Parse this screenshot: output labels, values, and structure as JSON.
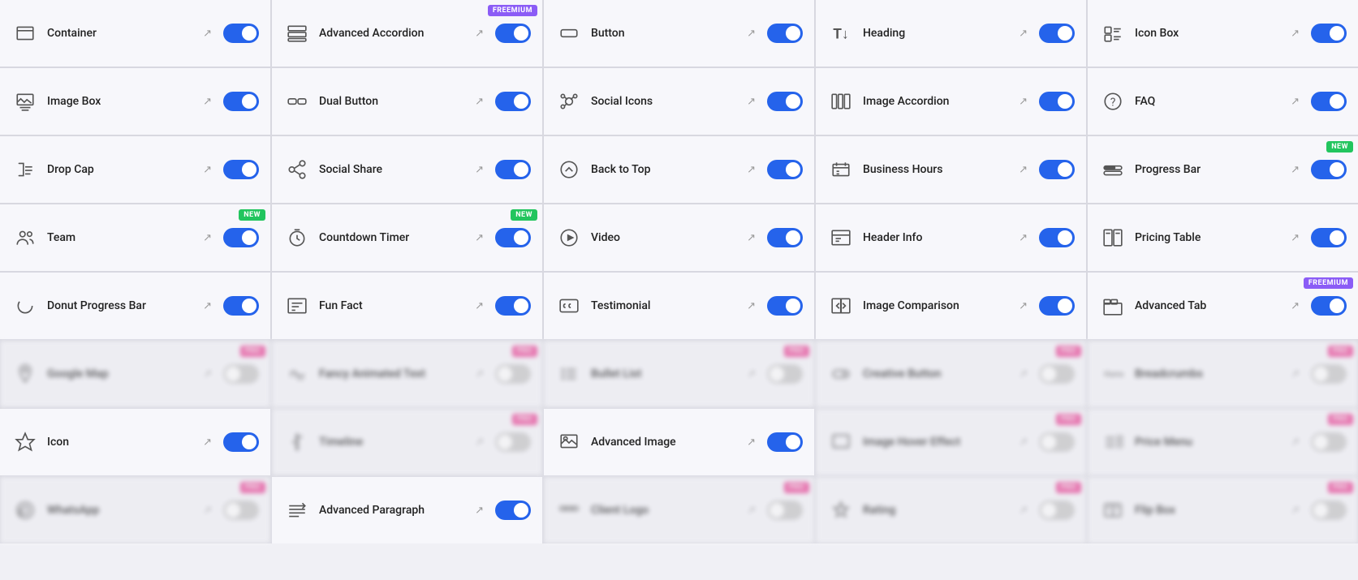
{
  "colors": {
    "toggle_on": "#2563eb",
    "toggle_off": "#cccccc",
    "badge_new": "#22c55e",
    "badge_freemium": "#8b5cf6",
    "badge_pro": "#ec4899"
  },
  "cells": [
    {
      "id": "container",
      "label": "Container",
      "icon": "container",
      "toggle": "on",
      "badge": null
    },
    {
      "id": "advanced-accordion",
      "label": "Advanced Accordion",
      "icon": "advanced-accordion",
      "toggle": "on",
      "badge": "freemium"
    },
    {
      "id": "button",
      "label": "Button",
      "icon": "button",
      "toggle": "on",
      "badge": null
    },
    {
      "id": "heading",
      "label": "Heading",
      "icon": "heading",
      "toggle": "on",
      "badge": null
    },
    {
      "id": "icon-box",
      "label": "Icon Box",
      "icon": "icon-box",
      "toggle": "on",
      "badge": null
    },
    {
      "id": "image-box",
      "label": "Image Box",
      "icon": "image-box",
      "toggle": "on",
      "badge": null
    },
    {
      "id": "dual-button",
      "label": "Dual Button",
      "icon": "dual-button",
      "toggle": "on",
      "badge": null
    },
    {
      "id": "social-icons",
      "label": "Social Icons",
      "icon": "social-icons",
      "toggle": "on",
      "badge": null
    },
    {
      "id": "image-accordion",
      "label": "Image Accordion",
      "icon": "image-accordion",
      "toggle": "on",
      "badge": null
    },
    {
      "id": "faq",
      "label": "FAQ",
      "icon": "faq",
      "toggle": "on",
      "badge": null
    },
    {
      "id": "drop-cap",
      "label": "Drop Cap",
      "icon": "drop-cap",
      "toggle": "on",
      "badge": null
    },
    {
      "id": "social-share",
      "label": "Social Share",
      "icon": "social-share",
      "toggle": "on",
      "badge": null
    },
    {
      "id": "back-to-top",
      "label": "Back to Top",
      "icon": "back-to-top",
      "toggle": "on",
      "badge": null
    },
    {
      "id": "business-hours",
      "label": "Business Hours",
      "icon": "business-hours",
      "toggle": "on",
      "badge": null
    },
    {
      "id": "progress-bar",
      "label": "Progress Bar",
      "icon": "progress-bar",
      "toggle": "on",
      "badge": "new"
    },
    {
      "id": "team",
      "label": "Team",
      "icon": "team",
      "toggle": "on",
      "badge": "new"
    },
    {
      "id": "countdown-timer",
      "label": "Countdown Timer",
      "icon": "countdown-timer",
      "toggle": "on",
      "badge": "new"
    },
    {
      "id": "video",
      "label": "Video",
      "icon": "video",
      "toggle": "on",
      "badge": null
    },
    {
      "id": "header-info",
      "label": "Header Info",
      "icon": "header-info",
      "toggle": "on",
      "badge": null
    },
    {
      "id": "pricing-table",
      "label": "Pricing Table",
      "icon": "pricing-table",
      "toggle": "on",
      "badge": null
    },
    {
      "id": "donut-progress-bar",
      "label": "Donut Progress Bar",
      "icon": "donut-progress",
      "toggle": "on",
      "badge": null
    },
    {
      "id": "fun-fact",
      "label": "Fun Fact",
      "icon": "fun-fact",
      "toggle": "on",
      "badge": null
    },
    {
      "id": "testimonial",
      "label": "Testimonial",
      "icon": "testimonial",
      "toggle": "on",
      "badge": null
    },
    {
      "id": "image-comparison",
      "label": "Image Comparison",
      "icon": "image-comparison",
      "toggle": "on",
      "badge": null
    },
    {
      "id": "advanced-tab",
      "label": "Advanced Tab",
      "icon": "advanced-tab",
      "toggle": "on",
      "badge": "freemium"
    },
    {
      "id": "google-map",
      "label": "Google Map",
      "icon": "google-map",
      "toggle": "off",
      "badge": "pro",
      "blurred": true
    },
    {
      "id": "fancy-animated-text",
      "label": "Fancy Animated Text",
      "icon": "fancy-animated",
      "toggle": "off",
      "badge": "pro",
      "blurred": true
    },
    {
      "id": "bullet-list",
      "label": "Bullet List",
      "icon": "bullet-list",
      "toggle": "off",
      "badge": "pro",
      "blurred": true
    },
    {
      "id": "creative-button",
      "label": "Creative Button",
      "icon": "creative-button",
      "toggle": "off",
      "badge": "pro",
      "blurred": true
    },
    {
      "id": "breadcrumbs",
      "label": "Breadcrumbs",
      "icon": "breadcrumbs",
      "toggle": "off",
      "badge": "pro",
      "blurred": true
    },
    {
      "id": "icon",
      "label": "Icon",
      "icon": "icon-widget",
      "toggle": "on",
      "badge": null
    },
    {
      "id": "timeline",
      "label": "Timeline",
      "icon": "timeline",
      "toggle": "off",
      "badge": "pro",
      "blurred": true
    },
    {
      "id": "advanced-image",
      "label": "Advanced Image",
      "icon": "advanced-image",
      "toggle": "on",
      "badge": null
    },
    {
      "id": "image-hover-effect",
      "label": "Image Hover Effect",
      "icon": "image-hover",
      "toggle": "off",
      "badge": "pro",
      "blurred": true
    },
    {
      "id": "price-menu",
      "label": "Price Menu",
      "icon": "price-menu",
      "toggle": "off",
      "badge": "pro",
      "blurred": true
    },
    {
      "id": "whatsapp",
      "label": "WhatsApp",
      "icon": "whatsapp",
      "toggle": "off",
      "badge": "pro",
      "blurred": true
    },
    {
      "id": "advanced-paragraph",
      "label": "Advanced Paragraph",
      "icon": "advanced-paragraph",
      "toggle": "on",
      "badge": null
    },
    {
      "id": "client-logo",
      "label": "Client Logo",
      "icon": "client-logo",
      "toggle": "off",
      "badge": "pro",
      "blurred": true
    },
    {
      "id": "rating",
      "label": "Rating",
      "icon": "rating",
      "toggle": "off",
      "badge": "pro",
      "blurred": true
    },
    {
      "id": "flip-box",
      "label": "Flip Box",
      "icon": "flip-box",
      "toggle": "off",
      "badge": "pro",
      "blurred": true
    }
  ]
}
